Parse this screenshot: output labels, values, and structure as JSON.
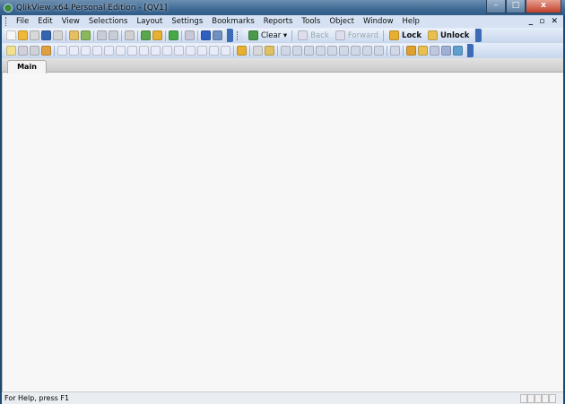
{
  "window": {
    "title": "QlikView x64 Personal Edition - [QV1]",
    "min": "–",
    "max": "□",
    "close": "x"
  },
  "menu": [
    "File",
    "Edit",
    "View",
    "Selections",
    "Layout",
    "Settings",
    "Bookmarks",
    "Reports",
    "Tools",
    "Object",
    "Window",
    "Help"
  ],
  "mdi": "_ ▫ ✕",
  "toolbar1": {
    "icons": [
      [
        "new-document-icon",
        "#f6f6f6"
      ],
      [
        "open-folder-icon",
        "#f0b838"
      ],
      [
        "open-server-icon",
        "#d8d8d8"
      ],
      [
        "save-icon",
        "#3466b0"
      ],
      [
        "print-icon",
        "#d5d5d5"
      ],
      [
        "sep",
        ""
      ],
      [
        "edit-script-icon",
        "#e6c060"
      ],
      [
        "reload-icon",
        "#8ab85a"
      ],
      [
        "sep",
        ""
      ],
      [
        "undo-icon",
        "#c8ccd6"
      ],
      [
        "redo-icon",
        "#c8ccd6"
      ],
      [
        "sep",
        ""
      ],
      [
        "search-icon",
        "#d0d0d0"
      ],
      [
        "sep",
        ""
      ],
      [
        "select-fields-icon",
        "#5aa64a"
      ],
      [
        "chart-wizard-icon",
        "#e8b030"
      ],
      [
        "sep",
        ""
      ],
      [
        "bookmark-star-icon",
        "#48a848"
      ],
      [
        "sep",
        ""
      ],
      [
        "properties-icon",
        "#c8c8d8"
      ],
      [
        "sep",
        ""
      ],
      [
        "help-icon",
        "#3060c0"
      ],
      [
        "context-help-icon",
        "#7090c0"
      ]
    ],
    "clear": "Clear ▾",
    "back": "Back",
    "forward": "Forward",
    "lock": "Lock",
    "unlock": "Unlock"
  },
  "toolbar2": {
    "icons": [
      [
        "new-sheet-icon",
        "#f0e090"
      ],
      [
        "promote-sheet-icon",
        "#d0d0d8"
      ],
      [
        "demote-sheet-icon",
        "#d0d0d8"
      ],
      [
        "sheet-properties-icon",
        "#e0a040"
      ],
      [
        "sep",
        ""
      ],
      [
        "listbox-icon",
        "#e8ecf8"
      ],
      [
        "statistics-box-icon",
        "#e8ecf8"
      ],
      [
        "multibox-icon",
        "#e8ecf8"
      ],
      [
        "table-box-icon",
        "#e8ecf8"
      ],
      [
        "chart-icon",
        "#e8ecf8"
      ],
      [
        "input-box-icon",
        "#e8ecf8"
      ],
      [
        "current-selections-icon",
        "#e8ecf8"
      ],
      [
        "button-object-icon",
        "#e8ecf8"
      ],
      [
        "text-object-icon",
        "#e8ecf8"
      ],
      [
        "line-arrow-icon",
        "#e8ecf8"
      ],
      [
        "slider-icon",
        "#e8ecf8"
      ],
      [
        "bookmark-object-icon",
        "#e8ecf8"
      ],
      [
        "search-object-icon",
        "#e8ecf8"
      ],
      [
        "container-icon",
        "#e8ecf8"
      ],
      [
        "custom-object-icon",
        "#e8ecf8"
      ],
      [
        "sep",
        ""
      ],
      [
        "design-grid-icon",
        "#e8b030"
      ],
      [
        "sep",
        ""
      ],
      [
        "format-painter-icon",
        "#d8d8d8"
      ],
      [
        "layout-icon",
        "#e0c060"
      ],
      [
        "sep",
        ""
      ],
      [
        "align-left-icon",
        "#d0d8e8"
      ],
      [
        "align-center-icon",
        "#d0d8e8"
      ],
      [
        "align-right-icon",
        "#d0d8e8"
      ],
      [
        "align-top-icon",
        "#d0d8e8"
      ],
      [
        "align-middle-icon",
        "#d0d8e8"
      ],
      [
        "align-bottom-icon",
        "#d0d8e8"
      ],
      [
        "space-horizontal-icon",
        "#d0d8e8"
      ],
      [
        "space-vertical-icon",
        "#d0d8e8"
      ],
      [
        "adjust-icon",
        "#d0d8e8"
      ],
      [
        "sep",
        ""
      ],
      [
        "same-size-icon",
        "#d0d8e8"
      ],
      [
        "sep",
        ""
      ],
      [
        "server-objects-icon",
        "#e0a030"
      ],
      [
        "new-folder-icon",
        "#e8c050"
      ],
      [
        "edit-object-icon",
        "#c0c8e0"
      ],
      [
        "link-objects-icon",
        "#9fb0d8"
      ],
      [
        "export-icon",
        "#60a0d0"
      ]
    ]
  },
  "tabs": [
    {
      "label": "Main"
    }
  ],
  "status": {
    "text": "For Help, press F1"
  }
}
